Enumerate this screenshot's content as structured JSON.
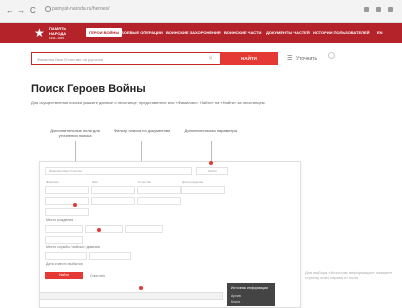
{
  "browser": {
    "back": "←",
    "forward": "→",
    "reload": "C",
    "url": "pamyat-naroda.ru/heroes/"
  },
  "logo": {
    "line1": "ПАМЯТЬ",
    "line2": "НАРОДА",
    "line3": "1941–1945"
  },
  "nav": {
    "items": [
      {
        "label": "ГЕРОИ ВОЙНЫ",
        "active": true
      },
      {
        "label": "БОЕВЫЕ ОПЕРАЦИИ"
      },
      {
        "label": "ВОИНСКИЕ ЗАХОРОНЕНИЯ"
      },
      {
        "label": "ВОИНСКИЕ ЧАСТИ"
      },
      {
        "label": "ДОКУМЕНТЫ ЧАСТЕЙ"
      },
      {
        "label": "ИСТОРИИ ПОЛЬЗОВАТЕЛЕЙ"
      },
      {
        "label": "EN"
      }
    ]
  },
  "search": {
    "placeholder": "Фамилия Имя Отчество на русском",
    "button": "НАЙТИ",
    "filter_label": "Уточнить"
  },
  "page": {
    "title": "Поиск Героев Войны",
    "description": "Для осуществления поиска укажите данные о пехотинце, представителе или «Фамилию». Найти» на «Найти» за пехотинцем."
  },
  "callouts": {
    "a": "Дополнительные поля для уточнения поиска",
    "b": "Фильтр поиска по документам",
    "c": "Дополнительная параметры",
    "d": "Источники информации"
  },
  "form": {
    "top_placeholder": "Фамилия Имя Отчество",
    "top_button": "Найти",
    "labels": [
      "Фамилия",
      "Имя",
      "Отчество",
      "Дата рождения"
    ],
    "section1": "Место рождения",
    "section2": "Место службы / войска / дивизии",
    "section3": "Дата и место выбытия",
    "submit": "Найти",
    "reset": "Очистить"
  },
  "dropdown": {
    "title": "Источник информации",
    "item1": "Архив",
    "item2": "Книги"
  },
  "toast": "Для выбора «Источник информации» нажмите стрелку вниз справа от поля."
}
